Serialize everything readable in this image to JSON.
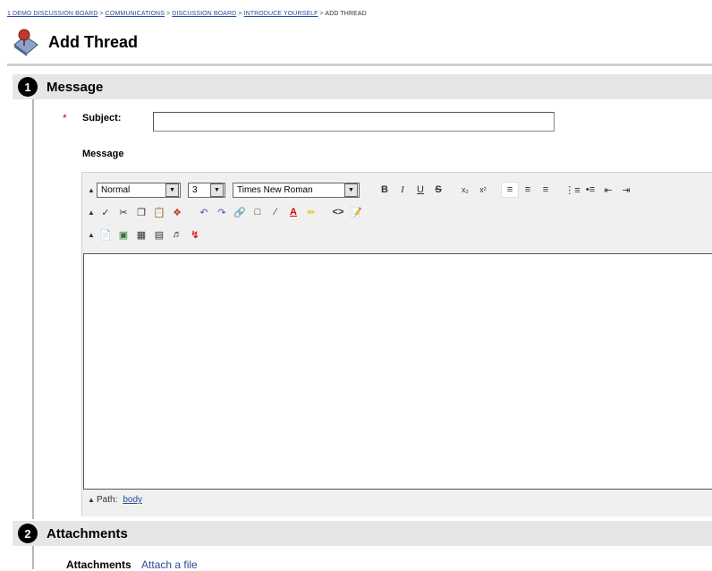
{
  "breadcrumb": [
    "1 DEMO DISCUSSION BOARD",
    "COMMUNICATIONS",
    "DISCUSSION BOARD",
    "INTRODUCE YOURSELF",
    "ADD THREAD"
  ],
  "page": {
    "title": "Add Thread"
  },
  "sections": [
    {
      "number": "1",
      "title": "Message"
    },
    {
      "number": "2",
      "title": "Attachments"
    }
  ],
  "form": {
    "required_mark": "*",
    "subject_label": "Subject:",
    "subject_value": "",
    "message_label": "Message"
  },
  "editor": {
    "format_select": "Normal",
    "size_select": "3",
    "font_select": "Times New Roman",
    "path_label": "Path:",
    "path_link": "body"
  },
  "attachments": {
    "label": "Attachments",
    "link": "Attach a file"
  },
  "colors": {
    "section_bg": "#e6e6e6",
    "link": "#2a4a9a",
    "required": "#dd0000"
  }
}
